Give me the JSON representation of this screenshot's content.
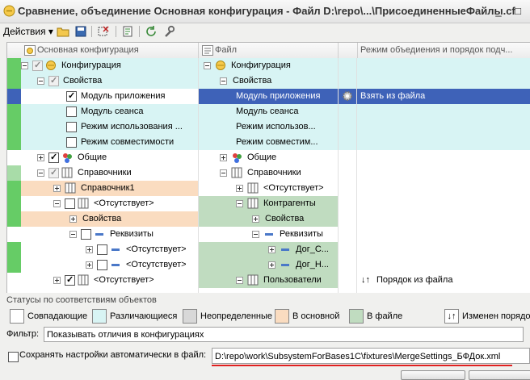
{
  "window": {
    "title": "Сравнение, объединение Основная конфигурация - Файл D:\\repo\\...\\ПрисоединенныеФайлы.cf",
    "minimize": "_",
    "maximize": "□"
  },
  "toolbar": {
    "actions_label": "Действия"
  },
  "columns": {
    "main": "Основная конфигурация",
    "file": "Файл",
    "mode": "Режим объедиения и порядок подч..."
  },
  "rows": [
    {
      "main": "Конфигурация",
      "file": "Конфигурация",
      "mode": ""
    },
    {
      "main": "Свойства",
      "file": "Свойства",
      "mode": ""
    },
    {
      "main": "Модуль приложения",
      "file": "Модуль приложения",
      "mode": "Взять из файла"
    },
    {
      "main": "Модуль сеанса",
      "file": "Модуль сеанса",
      "mode": ""
    },
    {
      "main": "Режим использования ...",
      "file": "Режим использов...",
      "mode": ""
    },
    {
      "main": "Режим совместимости",
      "file": "Режим совместим...",
      "mode": ""
    },
    {
      "main": "Общие",
      "file": "Общие",
      "mode": ""
    },
    {
      "main": "Справочники",
      "file": "Справочники",
      "mode": ""
    },
    {
      "main": "Справочник1",
      "file": "<Отсутствует>",
      "mode": ""
    },
    {
      "main": "<Отсутствует>",
      "file": "Контрагенты",
      "mode": ""
    },
    {
      "main": "Свойства",
      "file": "Свойства",
      "mode": ""
    },
    {
      "main": "Реквизиты",
      "file": "Реквизиты",
      "mode": ""
    },
    {
      "main": "<Отсутствует>",
      "file": "Дог_С...",
      "mode": ""
    },
    {
      "main": "<Отсутствует>",
      "file": "Дог_Н...",
      "mode": ""
    },
    {
      "main": "<Отсутствует>",
      "file": "Пользователи",
      "mode": "Порядок из файла"
    }
  ],
  "statuses": {
    "title": "Статусы по соответствиям объектов",
    "items": [
      {
        "label": "Совпадающие",
        "color": "#ffffff"
      },
      {
        "label": "Различающиеся",
        "color": "#d8f4f4"
      },
      {
        "label": "Неопределенные",
        "color": "#d8d8d8"
      },
      {
        "label": "В основной",
        "color": "#fadcc0"
      },
      {
        "label": "В файле",
        "color": "#c0dcc0"
      },
      {
        "label": "Изменен порядо",
        "color": ""
      }
    ]
  },
  "filter": {
    "label": "Фильтр:",
    "value": "Показывать отличия в конфигурациях"
  },
  "save": {
    "label": "Сохранять настройки автоматически в файл:",
    "path": "D:\\repo\\work\\SubsystemForBases1C\\fixtures\\MergeSettings_БФДок.xml"
  }
}
